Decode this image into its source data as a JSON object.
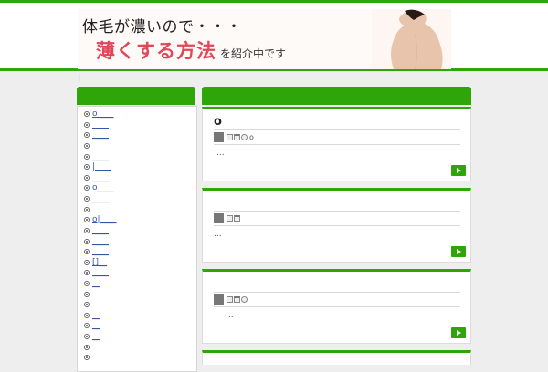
{
  "header": {
    "banner_line1": "体毛が濃いので・・・",
    "banner_line2_big": "薄くする方法",
    "banner_line2_small": "を紹介中です"
  },
  "breadcrumb": "|",
  "sidebar": {
    "items": [
      {
        "label": "o____"
      },
      {
        "label": "____"
      },
      {
        "label": "____"
      },
      {
        "label": ""
      },
      {
        "label": "____"
      },
      {
        "label": "|____"
      },
      {
        "label": "____"
      },
      {
        "label": "o____"
      },
      {
        "label": "____"
      },
      {
        "label": ""
      },
      {
        "label": "o|____"
      },
      {
        "label": "____"
      },
      {
        "label": "____"
      },
      {
        "label": "____"
      },
      {
        "label": "[]__"
      },
      {
        "label": "____"
      },
      {
        "label": "__"
      },
      {
        "label": ""
      },
      {
        "label": ""
      },
      {
        "label": "__"
      },
      {
        "label": "__"
      },
      {
        "label": "__"
      },
      {
        "label": ""
      },
      {
        "label": ""
      }
    ]
  },
  "posts": [
    {
      "title": "o",
      "meta_count": "o",
      "excerpt": "..."
    },
    {
      "title": "",
      "meta_count": "",
      "excerpt": "..."
    },
    {
      "title": "",
      "meta_count": "",
      "excerpt": "..."
    }
  ],
  "colors": {
    "accent": "#2ea60a",
    "link": "#3355aa"
  }
}
